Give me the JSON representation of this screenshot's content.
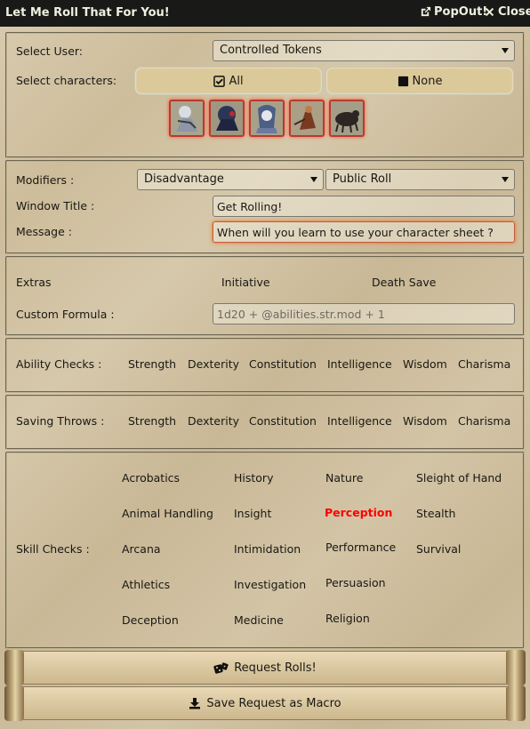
{
  "window": {
    "title": "Let Me Roll That For You!",
    "popout_label": "PopOut!",
    "close_label": "Close"
  },
  "users": {
    "label": "Select User:",
    "selected": "Controlled Tokens",
    "characters_label": "Select characters:",
    "all_label": "All",
    "none_label": "None",
    "tokens": [
      "Token 1",
      "Token 2",
      "Token 3",
      "Token 4",
      "Token 5"
    ]
  },
  "options": {
    "modifiers_label": "Modifiers :",
    "modifier_selected": "Disadvantage",
    "roll_mode_selected": "Public Roll",
    "window_title_label": "Window Title :",
    "window_title_value": "Get Rolling!",
    "message_label": "Message :",
    "message_value": "When will you learn to use your character sheet ?"
  },
  "extras": {
    "label": "Extras",
    "initiative": "Initiative",
    "death_save": "Death Save",
    "custom_formula_label": "Custom Formula :",
    "custom_formula_placeholder": "1d20 + @abilities.str.mod + 1"
  },
  "abilities": {
    "label": "Ability Checks :",
    "items": [
      "Strength",
      "Dexterity",
      "Constitution",
      "Intelligence",
      "Wisdom",
      "Charisma"
    ]
  },
  "saves": {
    "label": "Saving Throws :",
    "items": [
      "Strength",
      "Dexterity",
      "Constitution",
      "Intelligence",
      "Wisdom",
      "Charisma"
    ]
  },
  "skills": {
    "label": "Skill Checks :",
    "col1": [
      "Acrobatics",
      "Animal Handling",
      "Arcana",
      "Athletics",
      "Deception"
    ],
    "col2": [
      "History",
      "Insight",
      "Intimidation",
      "Investigation",
      "Medicine"
    ],
    "col3": [
      "Nature",
      "Perception",
      "Performance",
      "Persuasion",
      "Religion"
    ],
    "col4": [
      "Sleight of Hand",
      "Stealth",
      "Survival"
    ],
    "highlighted": "Perception",
    "highlight_color": "#ff0000"
  },
  "actions": {
    "request_label": "Request Rolls!",
    "macro_label": "Save Request as Macro"
  }
}
